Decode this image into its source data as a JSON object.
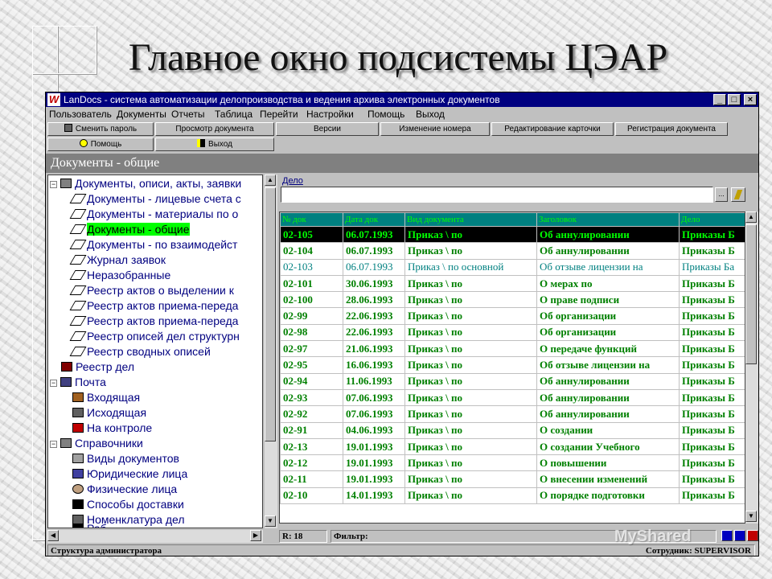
{
  "slide": {
    "title": "Главное окно подсистемы ЦЭАР",
    "watermark": "MyShared"
  },
  "window": {
    "title": "LanDocs - система автоматизации делопроизводства и ведения архива электронных документов",
    "app_icon": "W",
    "controls": {
      "minimize": "_",
      "maximize": "□",
      "close": "×"
    }
  },
  "menu": [
    "Пользователь",
    "Документы",
    "Отчеты",
    "Таблица",
    "Перейти",
    "Настройки",
    "Помощь",
    "Выход"
  ],
  "toolbar": {
    "row1": [
      "Сменить пароль",
      "Просмотр документа",
      "Версии",
      "Изменение номера",
      "Редактирование карточки",
      "Регистрация документа"
    ],
    "row2": [
      "Помощь",
      "Выход"
    ]
  },
  "section_title": "Документы - общие",
  "tree": [
    {
      "label": "Документы, описи, акты, заявки",
      "level": 0,
      "expander": "−",
      "icon": "folder-stack-icon"
    },
    {
      "label": "Документы - лицевые счета с",
      "level": 1,
      "icon": "tag-icon"
    },
    {
      "label": "Документы - материалы по о",
      "level": 1,
      "icon": "tag-icon"
    },
    {
      "label": "Документы - общие",
      "level": 1,
      "icon": "tag-icon",
      "selected": true
    },
    {
      "label": "Документы - по взаимодейст",
      "level": 1,
      "icon": "tag-icon"
    },
    {
      "label": "Журнал заявок",
      "level": 1,
      "icon": "tag-icon"
    },
    {
      "label": "Неразобранные",
      "level": 1,
      "icon": "tag-icon"
    },
    {
      "label": "Реестр актов о выделении к",
      "level": 1,
      "icon": "tag-icon"
    },
    {
      "label": "Реестр актов приема-переда",
      "level": 1,
      "icon": "tag-icon"
    },
    {
      "label": "Реестр актов приема-переда",
      "level": 1,
      "icon": "tag-icon"
    },
    {
      "label": "Реестр описей дел структурн",
      "level": 1,
      "icon": "tag-icon"
    },
    {
      "label": "Реестр сводных описей",
      "level": 1,
      "icon": "tag-icon"
    },
    {
      "label": "Реестр дел",
      "level": 0,
      "icon": "books-icon"
    },
    {
      "label": "Почта",
      "level": 0,
      "expander": "−",
      "icon": "mailbox-icon"
    },
    {
      "label": "Входящая",
      "level": 1,
      "icon": "inbox-icon"
    },
    {
      "label": "Исходящая",
      "level": 1,
      "icon": "outbox-icon"
    },
    {
      "label": "На контроле",
      "level": 1,
      "icon": "control-icon"
    },
    {
      "label": "Справочники",
      "level": 0,
      "expander": "−",
      "icon": "directory-icon"
    },
    {
      "label": "Виды документов",
      "level": 1,
      "icon": "doc-types-icon"
    },
    {
      "label": "Юридические лица",
      "level": 1,
      "icon": "building-icon"
    },
    {
      "label": "Физические лица",
      "level": 1,
      "icon": "person-icon"
    },
    {
      "label": "Способы доставки",
      "level": 1,
      "icon": "delivery-icon"
    },
    {
      "label": "Номенклатура дел",
      "level": 1,
      "icon": "nomenclature-icon"
    },
    {
      "label": "Раб",
      "level": 1,
      "icon": "work-icon"
    }
  ],
  "filter": {
    "label": "Дело",
    "value": "",
    "browse_label": "..."
  },
  "table": {
    "columns": [
      "№ док",
      "Дата док",
      "Вид документа",
      "Заголовок",
      "Дело"
    ],
    "rows": [
      [
        "02-105",
        "06.07.1993",
        "Приказ \\ по",
        "Об  аннулировании",
        "Приказы Б"
      ],
      [
        "02-104",
        "06.07.1993",
        "Приказ \\ по",
        "Об аннулировании",
        "Приказы Б"
      ],
      [
        "02-103",
        "06.07.1993",
        "Приказ \\ по основной",
        "Об отзыве лицензии на",
        "Приказы Ба"
      ],
      [
        "02-101",
        "30.06.1993",
        "Приказ \\ по",
        "О мерах по",
        "Приказы Б"
      ],
      [
        "02-100",
        "28.06.1993",
        "Приказ \\ по",
        "О праве подписи",
        "Приказы Б"
      ],
      [
        "02-99",
        "22.06.1993",
        "Приказ \\ по",
        "Об организации",
        "Приказы Б"
      ],
      [
        "02-98",
        "22.06.1993",
        "Приказ \\ по",
        "Об организации",
        "Приказы Б"
      ],
      [
        "02-97",
        "21.06.1993",
        "Приказ \\ по",
        "О передаче функций",
        "Приказы Б"
      ],
      [
        "02-95",
        "16.06.1993",
        "Приказ \\ по",
        "Об отзыве лицензии на",
        "Приказы Б"
      ],
      [
        "02-94",
        "11.06.1993",
        "Приказ \\ по",
        "Об аннулировании",
        "Приказы Б"
      ],
      [
        "02-93",
        "07.06.1993",
        "Приказ \\ по",
        "Об аннулировании",
        "Приказы Б"
      ],
      [
        "02-92",
        "07.06.1993",
        "Приказ \\ по",
        "Об аннулировании",
        "Приказы Б"
      ],
      [
        "02-91",
        "04.06.1993",
        "Приказ \\ по",
        "О создании",
        "Приказы Б"
      ],
      [
        "02-13",
        "19.01.1993",
        "Приказ \\ по",
        "О создании Учебного",
        "Приказы Б"
      ],
      [
        "02-12",
        "19.01.1993",
        "Приказ \\ по",
        "О повышении",
        "Приказы Б"
      ],
      [
        "02-11",
        "19.01.1993",
        "Приказ \\ по",
        "О внесении изменений",
        "Приказы Б"
      ],
      [
        "02-10",
        "14.01.1993",
        "Приказ \\ по",
        "О порядке подготовки",
        "Приказы Б"
      ]
    ],
    "selected_row": 0,
    "dim_row": 2
  },
  "status": {
    "record_count": "R: 18",
    "filter_label": "Фильтр:",
    "structure": "Структура администратора",
    "employee": "Сотрудник: SUPERVISOR"
  },
  "colors": {
    "titlebar": "#000080",
    "selected_tree": "#00ff00",
    "grid_text": "#008000",
    "grid_header_bg": "#008080"
  }
}
